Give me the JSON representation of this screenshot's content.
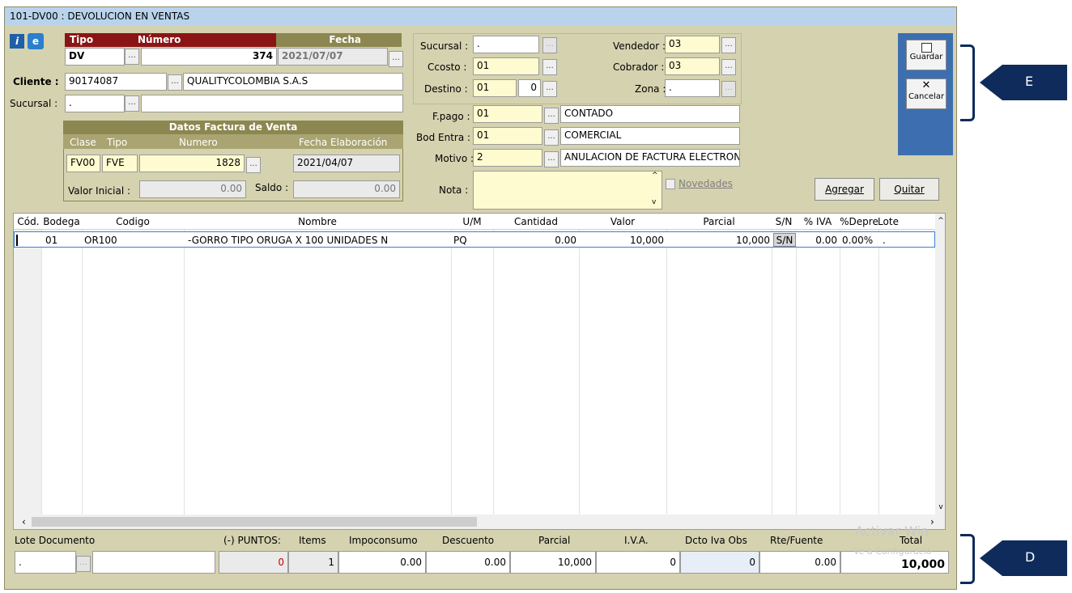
{
  "window": {
    "title": "101-DV00 : DEVOLUCION EN VENTAS"
  },
  "header": {
    "tipo_label": "Tipo",
    "numero_label": "Número",
    "fecha_label": "Fecha",
    "tipo_value": "DV",
    "numero_value": "374",
    "fecha_value": "2021/07/07",
    "cliente_label": "Cliente :",
    "cliente_id": "90174087",
    "cliente_name": "QUALITYCOLOMBIA S.A.S",
    "sucursal_label": "Sucursal :",
    "sucursal_value": ".",
    "info_icon": "i",
    "e_icon": "e"
  },
  "factura": {
    "title": "Datos Factura de Venta",
    "clase_label": "Clase",
    "tipo_label": "Tipo",
    "numero_label": "Numero",
    "fecha_label": "Fecha Elaboración",
    "clase": "FV00",
    "tipo": "FVE",
    "numero": "1828",
    "fecha": "2021/04/07",
    "valor_inicial_label": "Valor Inicial :",
    "valor_inicial": "0.00",
    "saldo_label": "Saldo :",
    "saldo": "0.00"
  },
  "middle": {
    "sucursal_label": "Sucursal :",
    "sucursal": ".",
    "ccosto_label": "Ccosto :",
    "ccosto": "01",
    "destino_label": "Destino :",
    "destino": "01",
    "destino_num": "0",
    "vendedor_label": "Vendedor :",
    "vendedor": "03",
    "cobrador_label": "Cobrador :",
    "cobrador": "03",
    "zona_label": "Zona :",
    "zona": ".",
    "fpago_label": "F.pago :",
    "fpago": "01",
    "fpago_desc": "CONTADO",
    "bod_label": "Bod Entra :",
    "bod": "01",
    "bod_desc": "COMERCIAL",
    "motivo_label": "Motivo :",
    "motivo": "2",
    "motivo_desc": "ANULACION DE FACTURA ELECTRON",
    "nota_label": "Nota :",
    "novedades": "Novedades"
  },
  "toolbar": {
    "guardar": "Guardar",
    "cancelar": "Cancelar",
    "agregar": "Agregar",
    "quitar": "Quitar"
  },
  "grid": {
    "columns": [
      "Cód.",
      "Bodega",
      "Codigo",
      "Nombre",
      "U/M",
      "Cantidad",
      "Valor",
      "Parcial",
      "S/N",
      "% IVA",
      "%Depre",
      "Lote"
    ],
    "rows": [
      {
        "cod": "",
        "bodega": "01",
        "codigo": "OR100",
        "nombre": "-GORRO TIPO ORUGA X 100 UNIDADES N",
        "um": "PQ",
        "cantidad": "0.00",
        "valor": "10,000",
        "parcial": "10,000",
        "sn": "S/N",
        "iva": "0.00",
        "depre": "0.00%",
        "lote": "."
      }
    ]
  },
  "footer": {
    "lote_label": "Lote Documento",
    "puntos_label": "(-) PUNTOS:",
    "items_label": "Items",
    "impo_label": "Impoconsumo",
    "desc_label": "Descuento",
    "parcial_label": "Parcial",
    "iva_label": "I.V.A.",
    "dcto_label": "Dcto Iva Obs",
    "rte_label": "Rte/Fuente",
    "total_label": "Total",
    "lote": ".",
    "puntos": "0",
    "items": "1",
    "impo": "0.00",
    "descuento": "0.00",
    "parcial": "10,000",
    "iva": "0",
    "dcto": "0",
    "rte": "0.00",
    "total": "10,000"
  },
  "watermark": {
    "line1": "Activar Win",
    "line2": "Ve a Configuració"
  },
  "callouts": {
    "e": "E",
    "d": "D"
  }
}
